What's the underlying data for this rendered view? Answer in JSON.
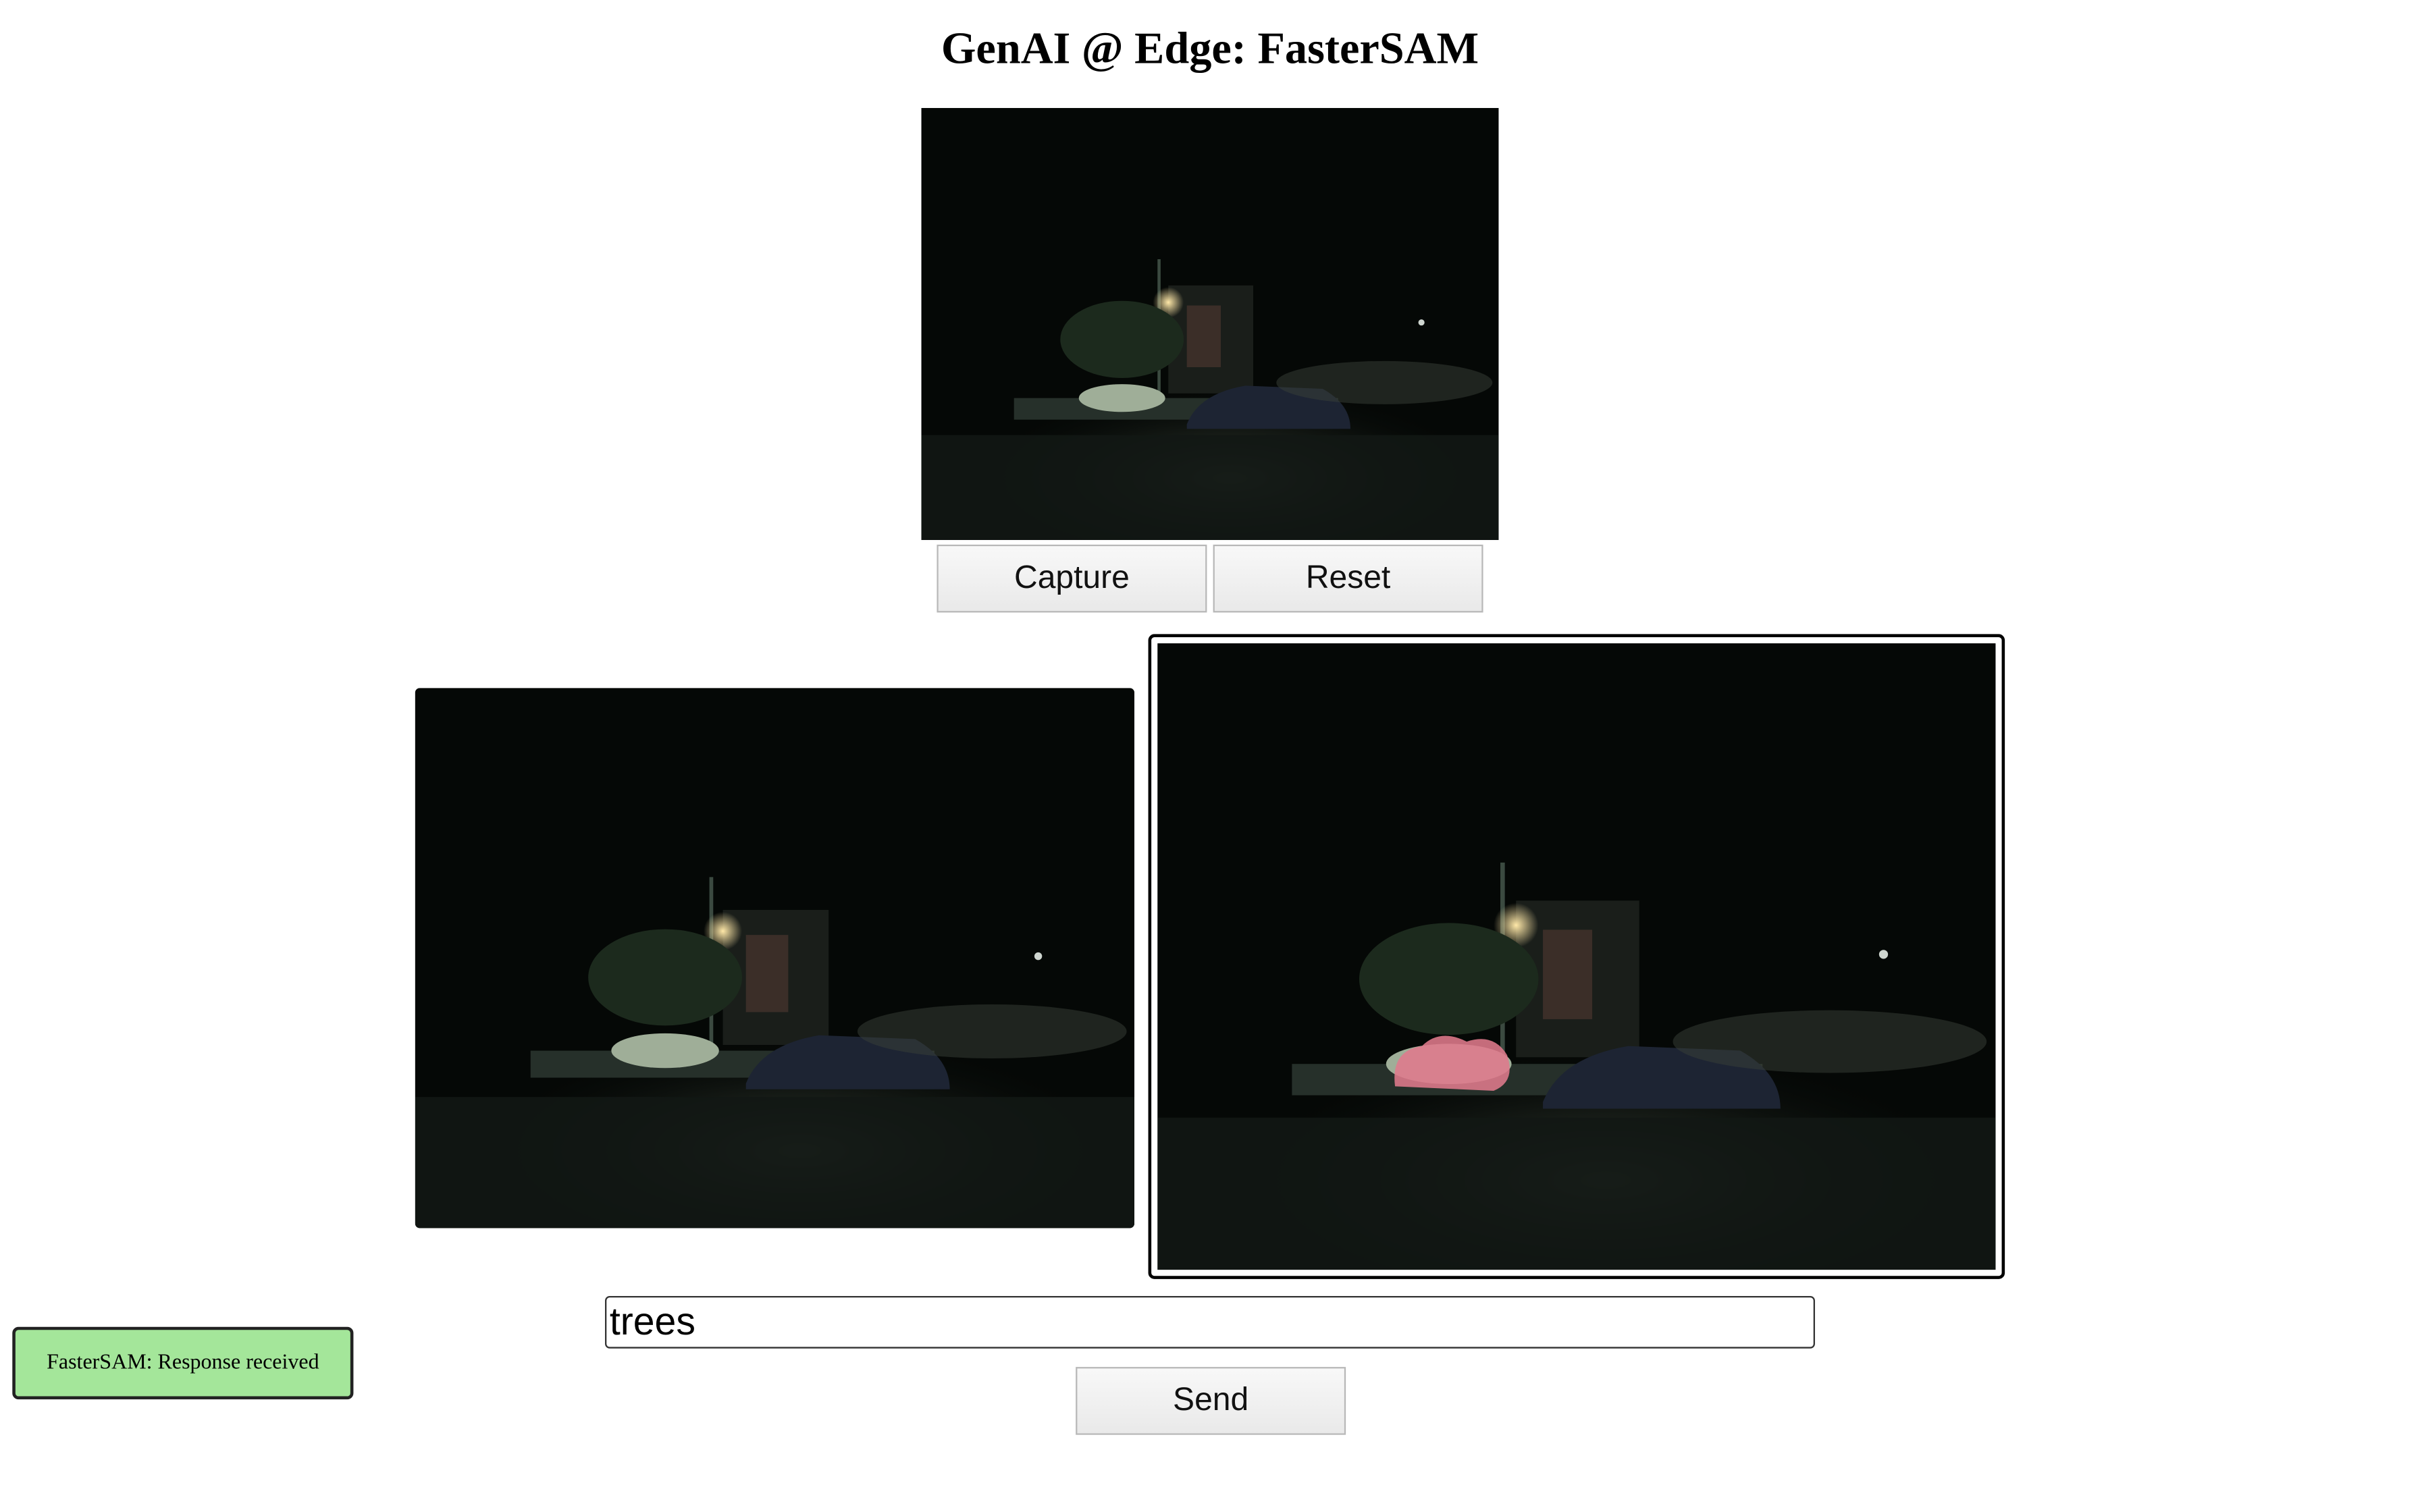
{
  "header": {
    "title": "GenAI @ Edge: FasterSAM"
  },
  "camera": {
    "capture_label": "Capture",
    "reset_label": "Reset"
  },
  "prompt": {
    "value": "trees"
  },
  "actions": {
    "send_label": "Send"
  },
  "status": {
    "message": "FasterSAM: Response received",
    "color": "#a4e69a"
  },
  "colors": {
    "frame_bg": "#050806",
    "mask": "#e07a8c"
  }
}
